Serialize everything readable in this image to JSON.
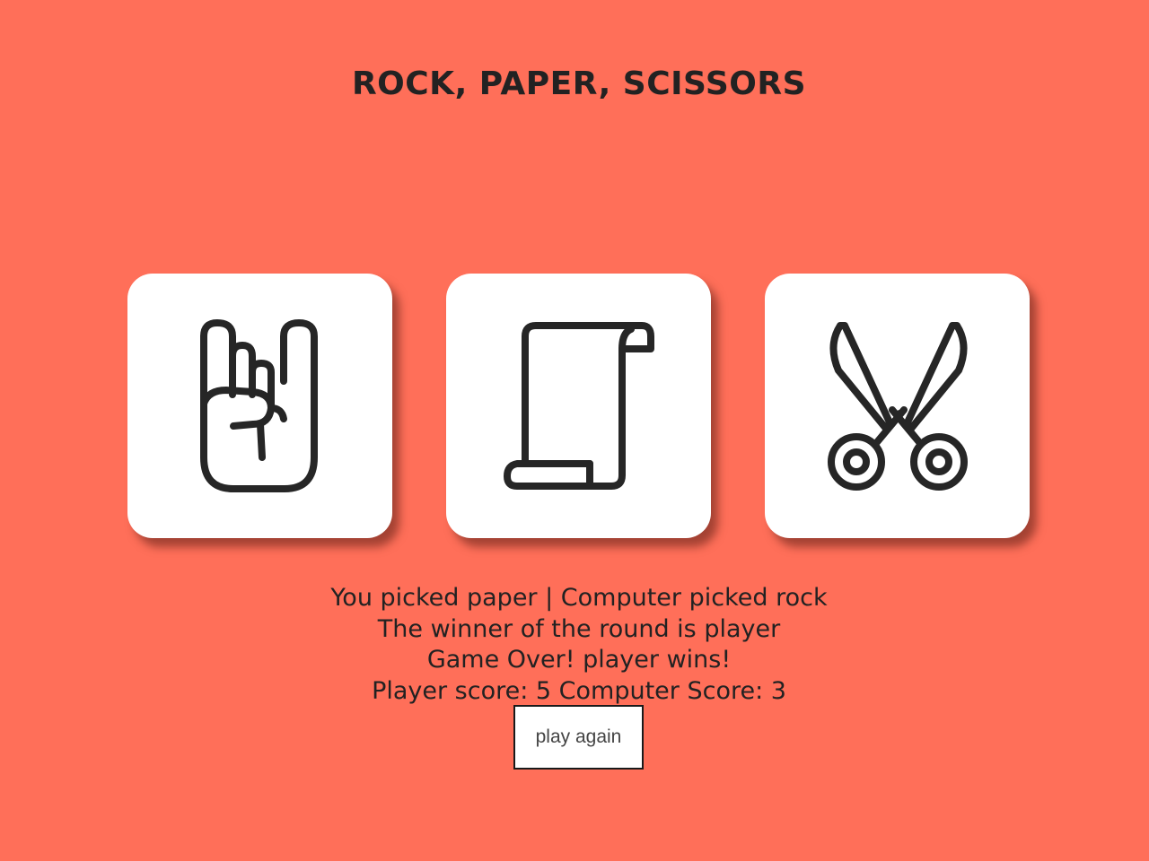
{
  "header": {
    "title": "ROCK, PAPER, SCISSORS"
  },
  "choices": [
    {
      "label": "rock",
      "icon": "rock-hand-icon"
    },
    {
      "label": "paper",
      "icon": "paper-scroll-icon"
    },
    {
      "label": "scissors",
      "icon": "scissors-icon"
    }
  ],
  "results": {
    "picks": "You picked paper | Computer picked rock",
    "round_winner": "The winner of the round is player",
    "game_over": "Game Over! player wins!",
    "score": "Player score: 5 Computer Score: 3"
  },
  "actions": {
    "play_again_label": "play again"
  },
  "colors": {
    "background": "#ff6f59",
    "card": "#ffffff",
    "ink": "#222222"
  }
}
